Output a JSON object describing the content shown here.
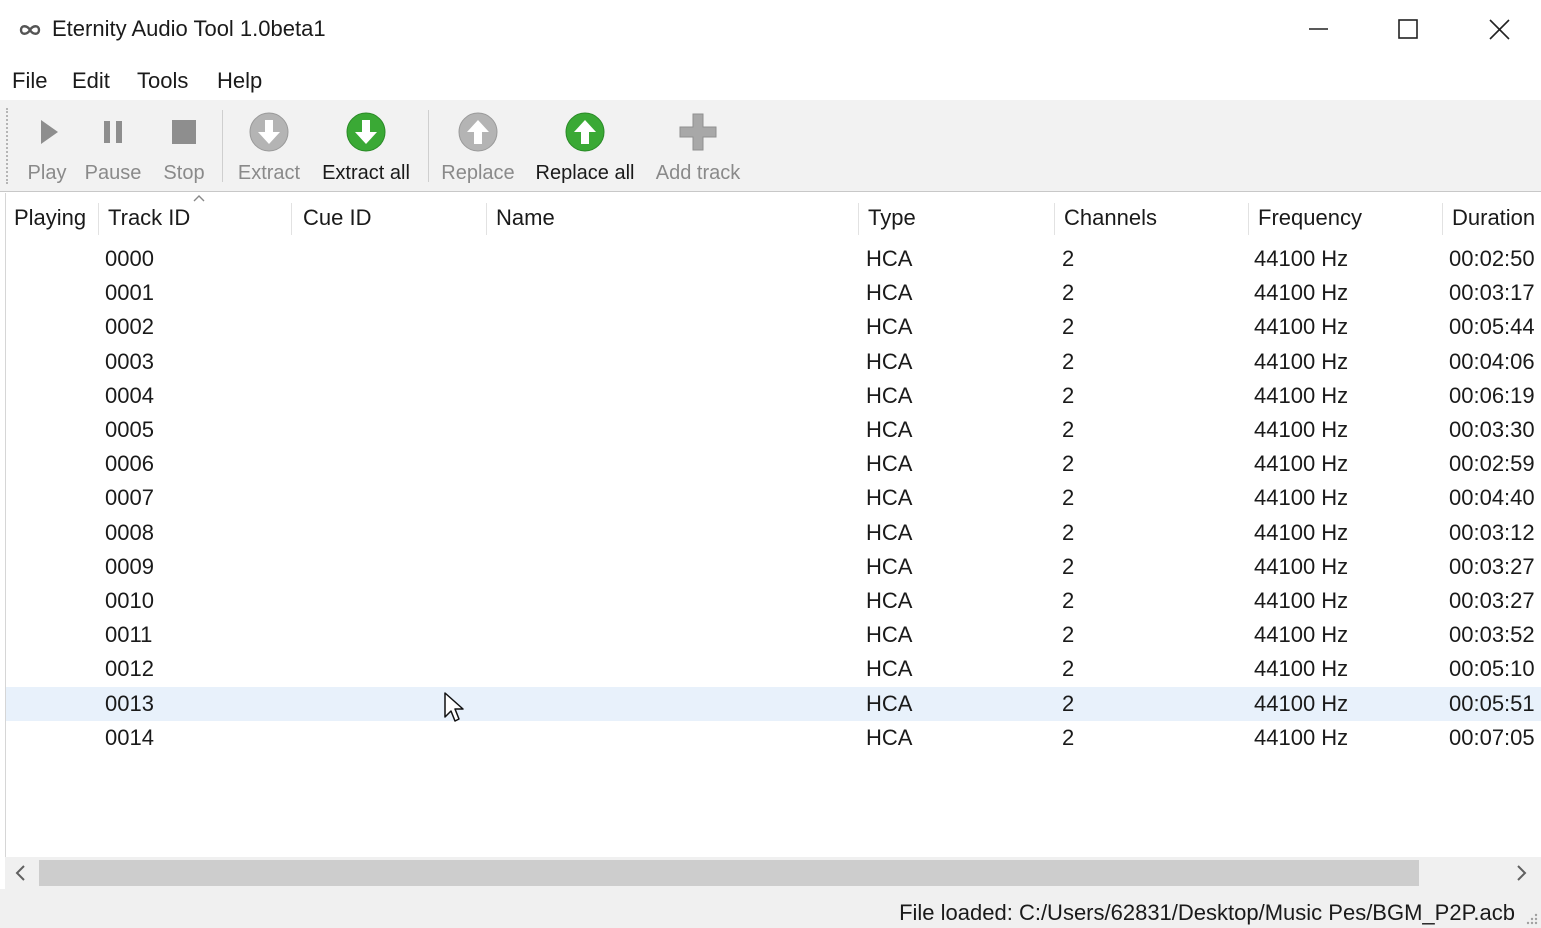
{
  "window": {
    "title": "Eternity Audio Tool 1.0beta1",
    "app_icon": "infinity-icon",
    "controls": [
      "minimize-icon",
      "maximize-icon",
      "close-icon"
    ]
  },
  "menu": {
    "items": [
      "File",
      "Edit",
      "Tools",
      "Help"
    ]
  },
  "toolbar": {
    "buttons": [
      {
        "label": "Play",
        "icon": "play-icon",
        "enabled": false
      },
      {
        "label": "Pause",
        "icon": "pause-icon",
        "enabled": false
      },
      {
        "label": "Stop",
        "icon": "stop-icon",
        "enabled": false
      },
      {
        "label": "Extract",
        "icon": "extract-icon",
        "enabled": false
      },
      {
        "label": "Extract all",
        "icon": "extract-all-icon",
        "enabled": true
      },
      {
        "label": "Replace",
        "icon": "replace-icon",
        "enabled": false
      },
      {
        "label": "Replace all",
        "icon": "replace-all-icon",
        "enabled": true
      },
      {
        "label": "Add track",
        "icon": "add-track-icon",
        "enabled": false
      }
    ],
    "colors": {
      "enabled_accent": "#3aa935",
      "disabled": "#a0a0a0"
    }
  },
  "table": {
    "columns": [
      "Playing",
      "Track ID",
      "Cue ID",
      "Name",
      "Type",
      "Channels",
      "Frequency",
      "Duration"
    ],
    "sorted_column": "Track ID",
    "rows": [
      {
        "track_id": "0000",
        "type": "HCA",
        "channels": "2",
        "frequency": "44100 Hz",
        "duration": "00:02:50"
      },
      {
        "track_id": "0001",
        "type": "HCA",
        "channels": "2",
        "frequency": "44100 Hz",
        "duration": "00:03:17"
      },
      {
        "track_id": "0002",
        "type": "HCA",
        "channels": "2",
        "frequency": "44100 Hz",
        "duration": "00:05:44"
      },
      {
        "track_id": "0003",
        "type": "HCA",
        "channels": "2",
        "frequency": "44100 Hz",
        "duration": "00:04:06"
      },
      {
        "track_id": "0004",
        "type": "HCA",
        "channels": "2",
        "frequency": "44100 Hz",
        "duration": "00:06:19"
      },
      {
        "track_id": "0005",
        "type": "HCA",
        "channels": "2",
        "frequency": "44100 Hz",
        "duration": "00:03:30"
      },
      {
        "track_id": "0006",
        "type": "HCA",
        "channels": "2",
        "frequency": "44100 Hz",
        "duration": "00:02:59"
      },
      {
        "track_id": "0007",
        "type": "HCA",
        "channels": "2",
        "frequency": "44100 Hz",
        "duration": "00:04:40"
      },
      {
        "track_id": "0008",
        "type": "HCA",
        "channels": "2",
        "frequency": "44100 Hz",
        "duration": "00:03:12"
      },
      {
        "track_id": "0009",
        "type": "HCA",
        "channels": "2",
        "frequency": "44100 Hz",
        "duration": "00:03:27"
      },
      {
        "track_id": "0010",
        "type": "HCA",
        "channels": "2",
        "frequency": "44100 Hz",
        "duration": "00:03:27"
      },
      {
        "track_id": "0011",
        "type": "HCA",
        "channels": "2",
        "frequency": "44100 Hz",
        "duration": "00:03:52"
      },
      {
        "track_id": "0012",
        "type": "HCA",
        "channels": "2",
        "frequency": "44100 Hz",
        "duration": "00:05:10"
      },
      {
        "track_id": "0013",
        "type": "HCA",
        "channels": "2",
        "frequency": "44100 Hz",
        "duration": "00:05:51",
        "hovered": true
      },
      {
        "track_id": "0014",
        "type": "HCA",
        "channels": "2",
        "frequency": "44100 Hz",
        "duration": "00:07:05"
      }
    ],
    "hover_color": "#e8f1fb"
  },
  "status": {
    "text": "File loaded: C:/Users/62831/Desktop/Music Pes/BGM_P2P.acb"
  }
}
